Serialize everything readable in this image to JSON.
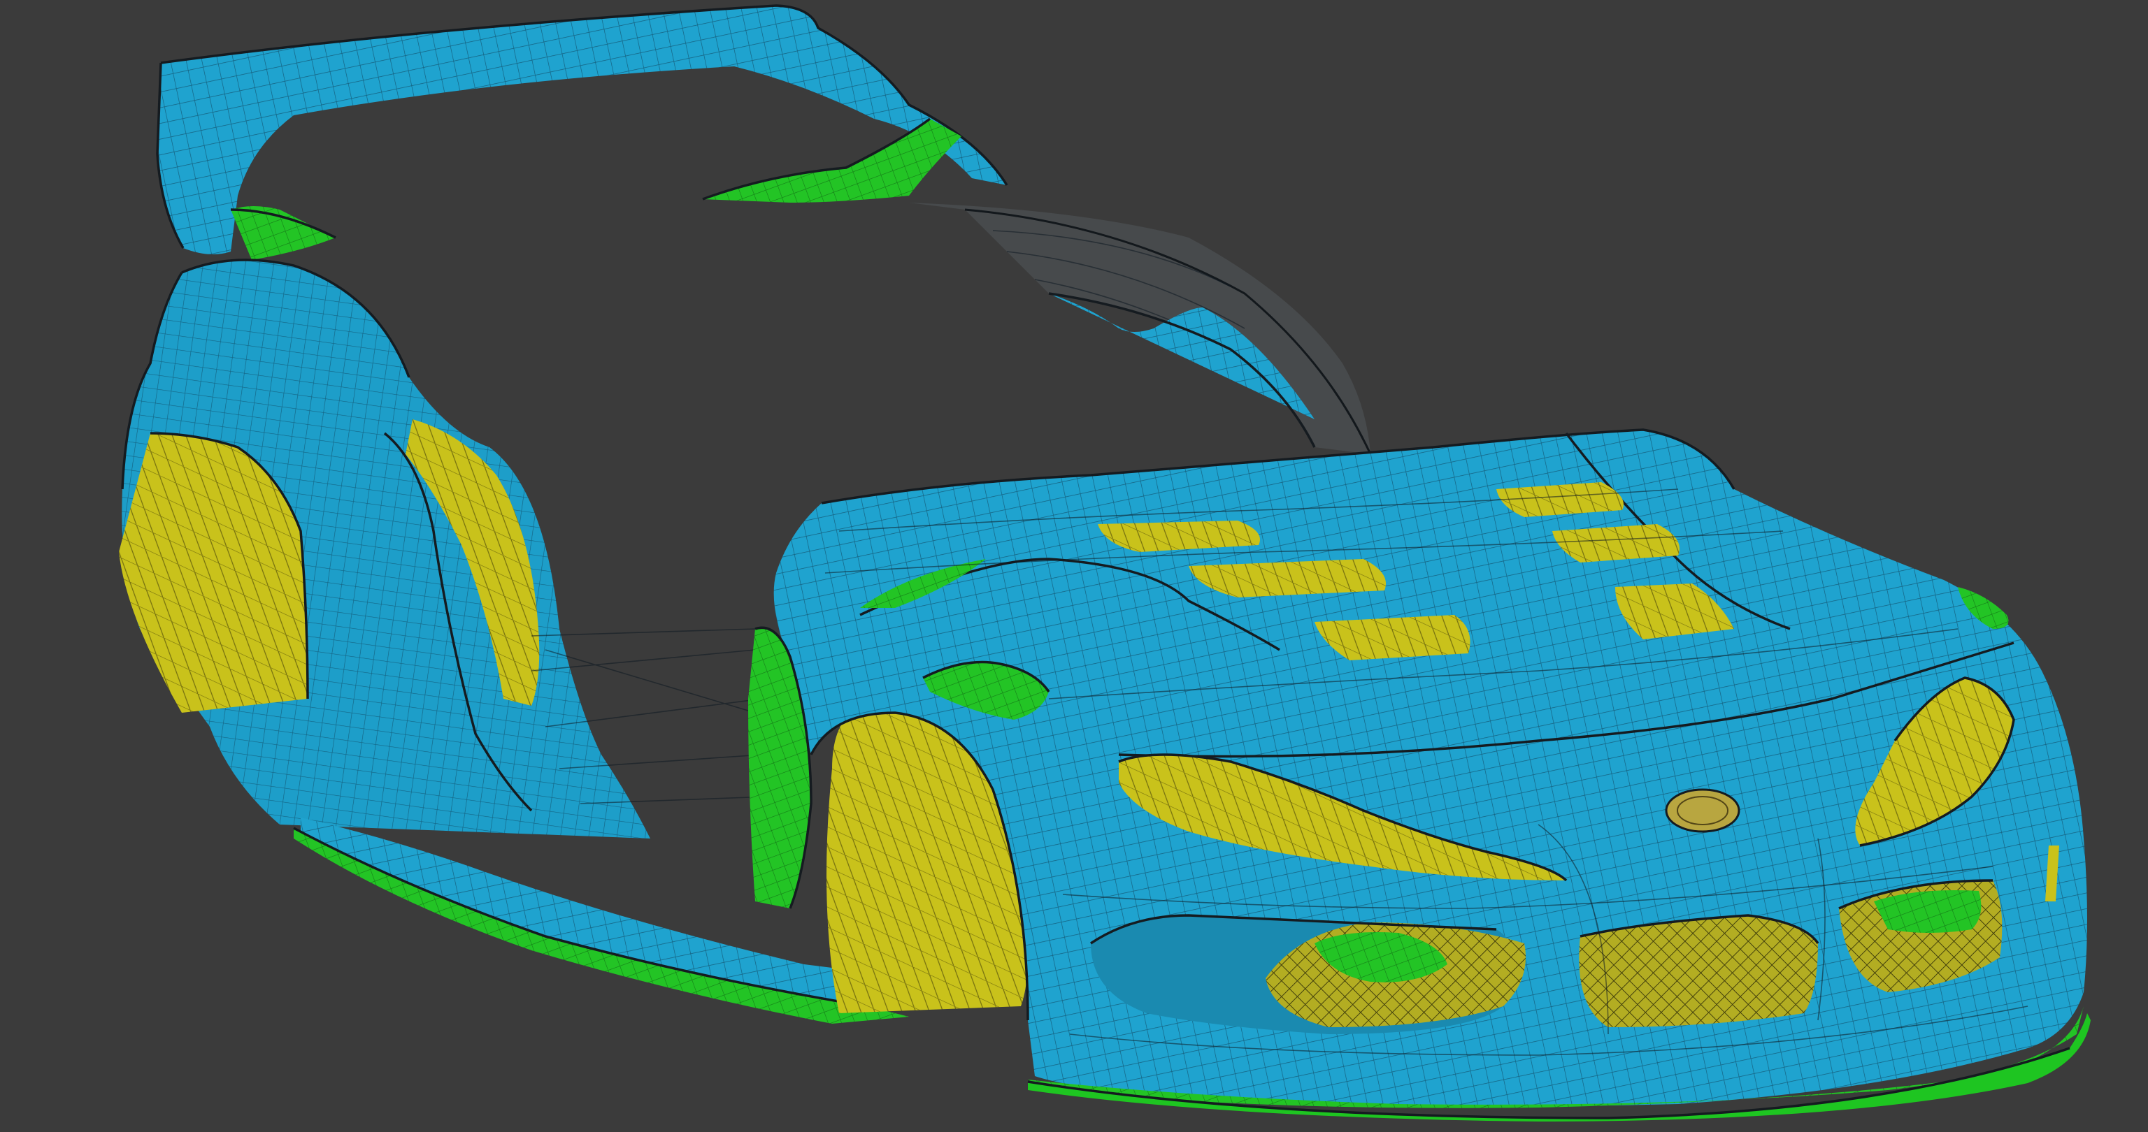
{
  "scene": {
    "description_colors": {
      "background": "#3b3b3b",
      "body_panels": "#1fa3cf",
      "inner_surfaces": "#c8c21a",
      "trim_parts": "#22c222",
      "badge": "#b8a640"
    }
  }
}
